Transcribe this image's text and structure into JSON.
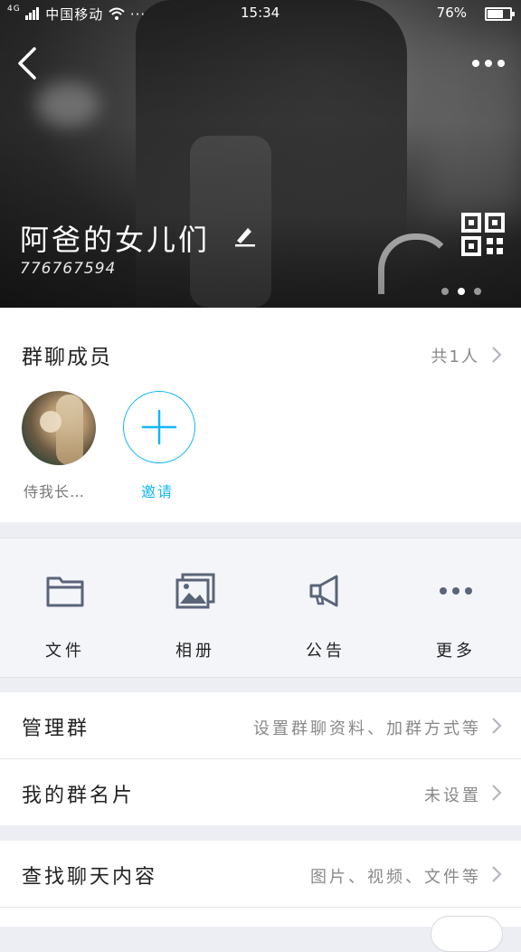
{
  "status_bar": {
    "signal": "4G",
    "carrier": "中国移动",
    "wifi": "wifi-icon",
    "extra": "···",
    "time": "15:34",
    "battery": "76%",
    "battery_level": 0.76
  },
  "header": {
    "group_name": "阿爸的女儿们",
    "group_id": "776767594",
    "carousel_pages": 3,
    "carousel_active": 1
  },
  "members": {
    "title": "群聊成员",
    "count": "共1人",
    "items": [
      {
        "name": "侍我长…"
      }
    ],
    "invite_label": "邀请"
  },
  "tools": [
    {
      "label": "文件",
      "icon": "folder-icon"
    },
    {
      "label": "相册",
      "icon": "album-icon"
    },
    {
      "label": "公告",
      "icon": "megaphone-icon"
    },
    {
      "label": "更多",
      "icon": "more-dots-icon"
    }
  ],
  "settings": [
    {
      "key": "管理群",
      "value": "设置群聊资料、加群方式等"
    },
    {
      "key": "我的群名片",
      "value": "未设置"
    },
    {
      "key": "查找聊天内容",
      "value": "图片、视频、文件等"
    }
  ],
  "colors": {
    "accent": "#12b7f5",
    "icon": "#5a6478",
    "background": "#eceef3"
  }
}
